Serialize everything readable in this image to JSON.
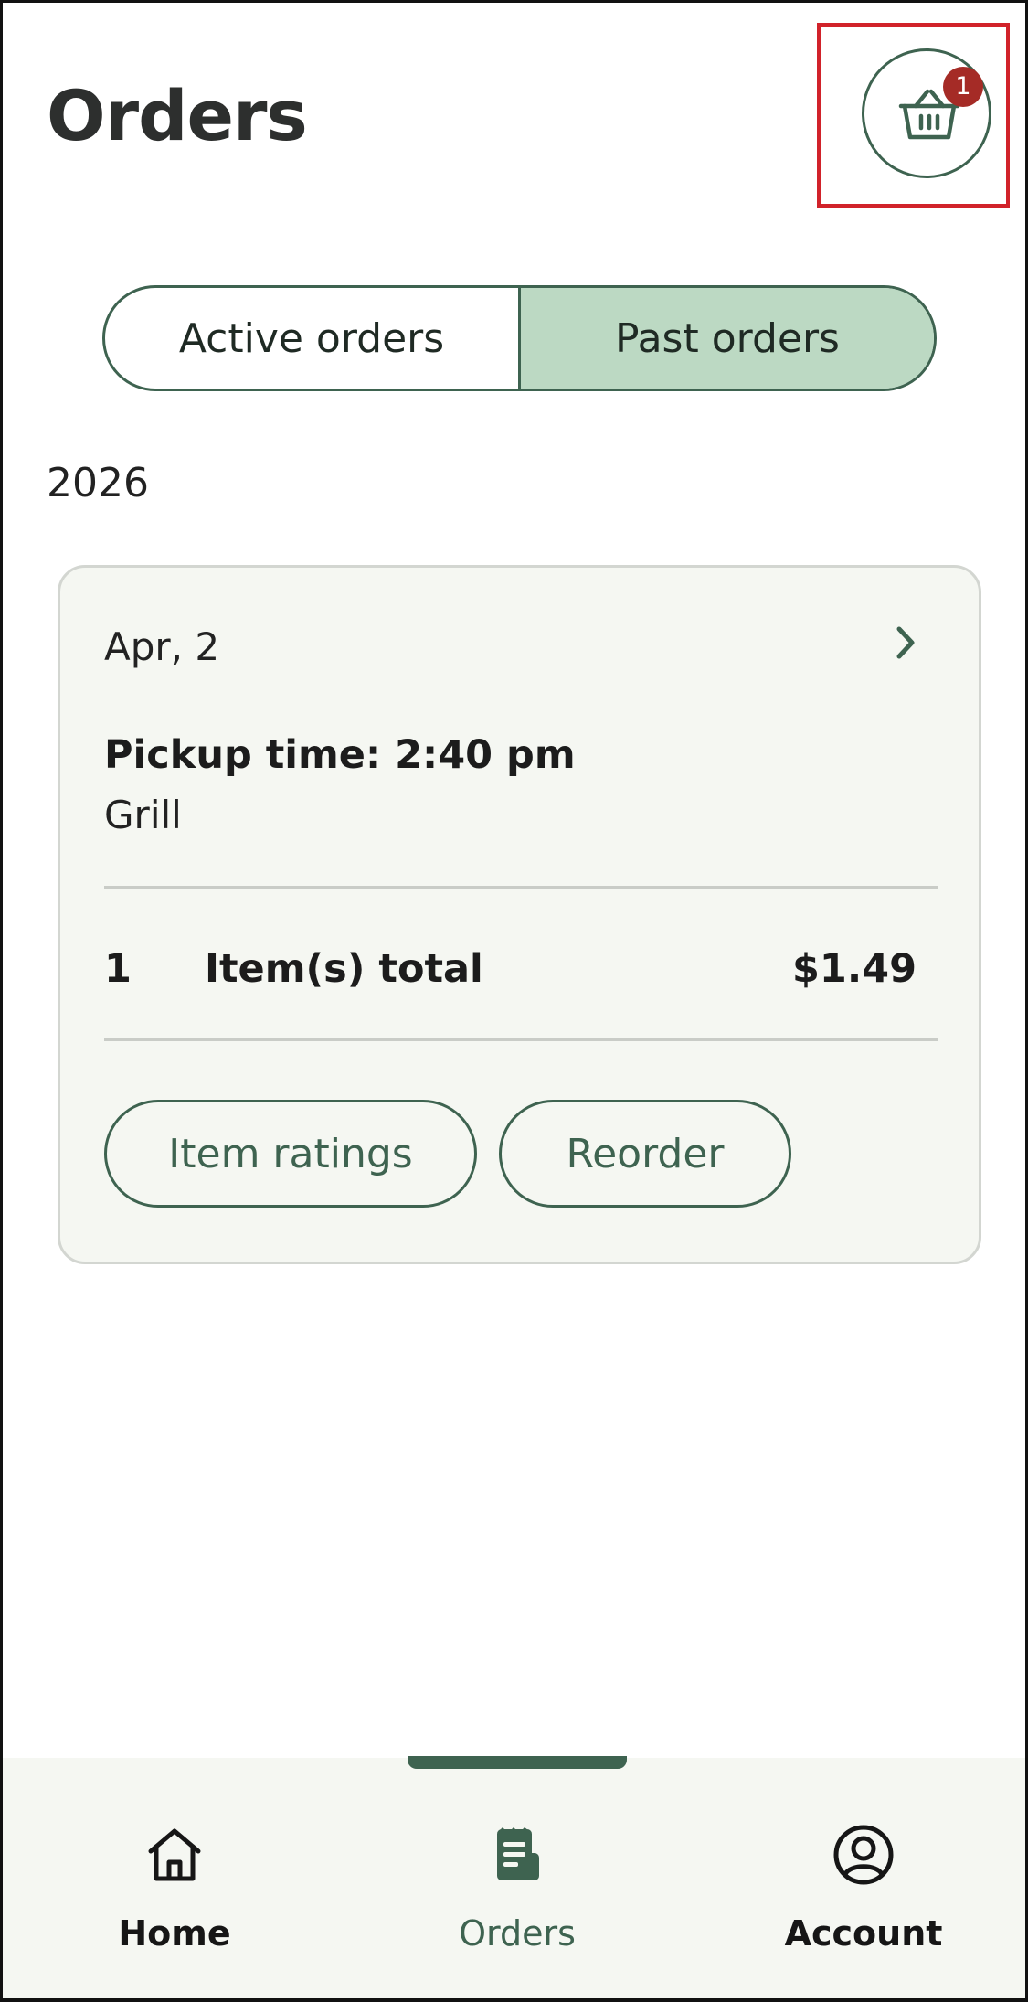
{
  "header": {
    "title": "Orders",
    "basket_icon": "basket-icon",
    "basket_badge_count": "1"
  },
  "tabs": [
    {
      "label": "Active orders",
      "selected": false
    },
    {
      "label": "Past orders",
      "selected": true
    }
  ],
  "year": "2026",
  "order": {
    "date": "Apr, 2",
    "pickup_time": "Pickup time: 2:40 pm",
    "location": "Grill",
    "item_count": "1",
    "items_label": "Item(s) total",
    "total": "$1.49",
    "buttons": {
      "ratings_label": "Item ratings",
      "reorder_label": "Reorder"
    }
  },
  "bottom_nav": {
    "items": [
      {
        "label": "Home",
        "icon": "home-icon",
        "active": false
      },
      {
        "label": "Orders",
        "icon": "receipt-icon",
        "active": true
      },
      {
        "label": "Account",
        "icon": "account-icon",
        "active": false
      }
    ]
  },
  "colors": {
    "accent": "#3e6350",
    "selected_tab": "#bcd9c3",
    "badge": "#a52b26",
    "card_background": "#f5f7f2",
    "highlight_box": "#d1222a"
  }
}
